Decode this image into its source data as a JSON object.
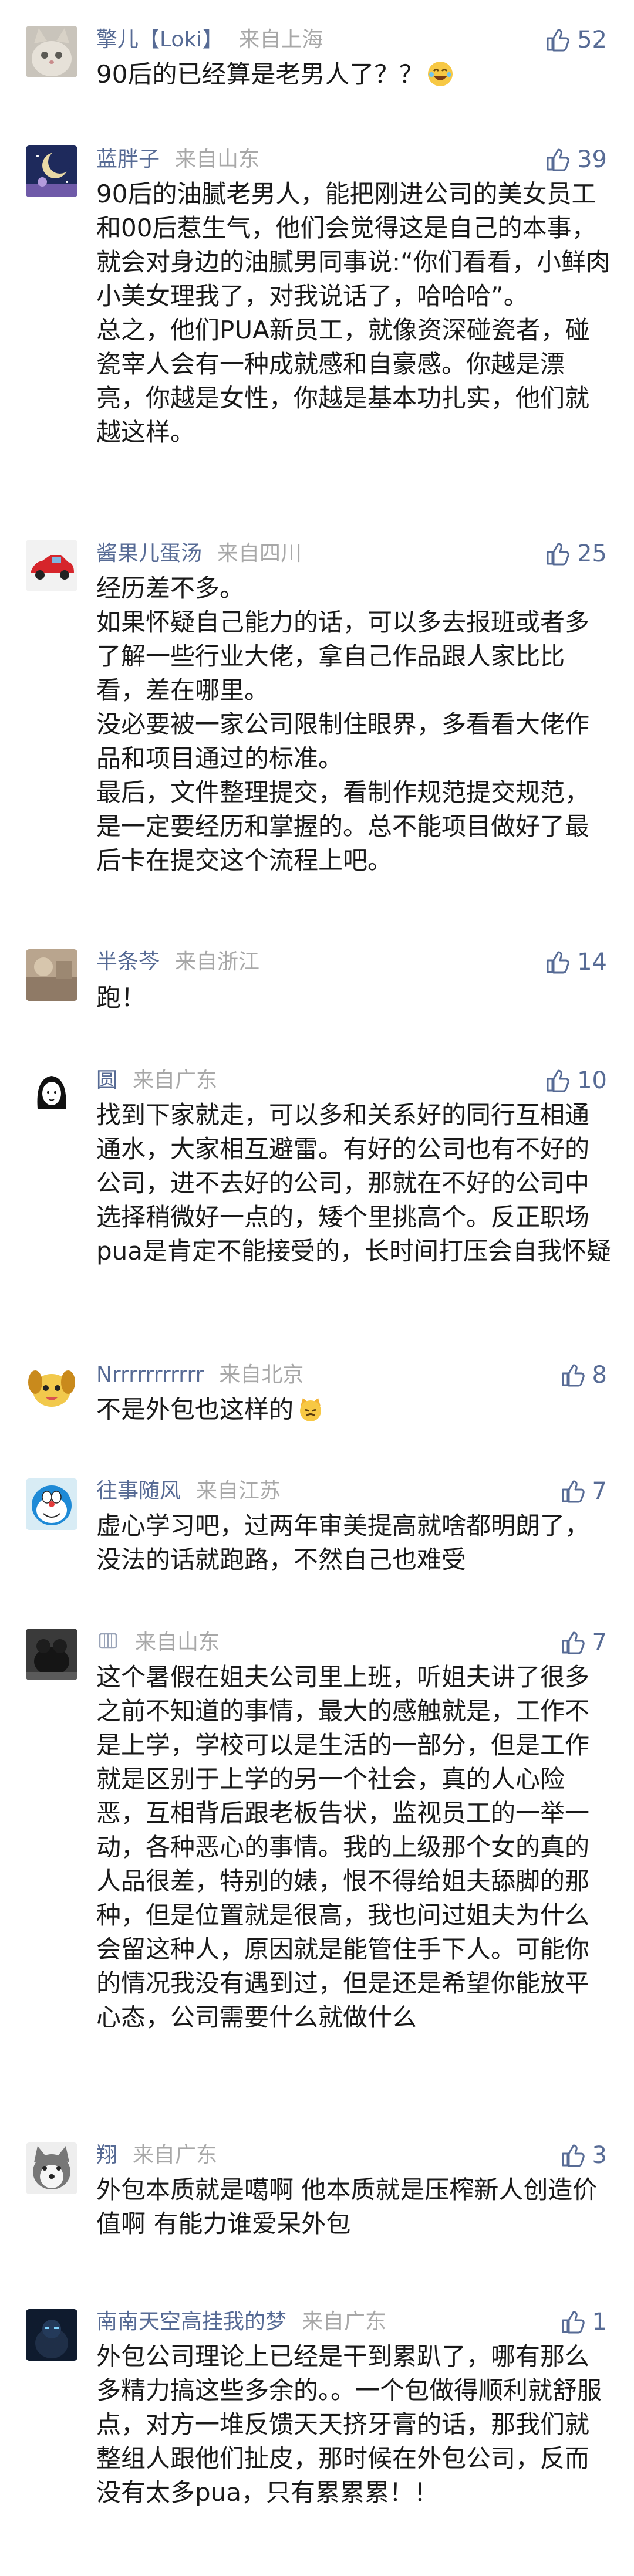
{
  "colors": {
    "nickname": "#576b95",
    "location": "#a8a8a8",
    "text": "#1a1a1a",
    "like": "#576b95"
  },
  "comments": [
    {
      "nickname": "擎儿【Loki】",
      "location": "来自上海",
      "likes": "52",
      "avatar": "cat-avatar",
      "paragraphs": [
        "90后的已经算是老男人了？？"
      ],
      "emoji": "laughing-emoji"
    },
    {
      "nickname": "蓝胖子",
      "location": "来自山东",
      "likes": "39",
      "avatar": "moon-night-avatar",
      "paragraphs": [
        "90后的油腻老男人，能把刚进公司的美女员工和00后惹生气，他们会觉得这是自己的本事，就会对身边的油腻男同事说:“你们看看，小鲜肉小美女理我了，对我说话了，哈哈哈”。",
        "总之，他们PUA新员工，就像资深碰瓷者，碰瓷宰人会有一种成就感和自豪感。你越是漂亮，你越是女性，你越是基本功扎实，他们就越这样。"
      ]
    },
    {
      "nickname": "酱果儿蛋汤",
      "location": "来自四川",
      "likes": "25",
      "avatar": "red-car-avatar",
      "paragraphs": [
        "经历差不多。",
        "如果怀疑自己能力的话，可以多去报班或者多了解一些行业大佬，拿自己作品跟人家比比看，差在哪里。",
        "没必要被一家公司限制住眼界，多看看大佬作品和项目通过的标准。",
        "最后，文件整理提交，看制作规范提交规范，是一定要经历和掌握的。总不能项目做好了最后卡在提交这个流程上吧。"
      ]
    },
    {
      "nickname": "半条芩",
      "location": "来自浙江",
      "likes": "14",
      "avatar": "blurry-photo-avatar",
      "paragraphs": [
        "跑！"
      ]
    },
    {
      "nickname": "圆",
      "location": "来自广东",
      "likes": "10",
      "avatar": "girl-sketch-avatar",
      "paragraphs": [
        "找到下家就走，可以多和关系好的同行互相通通水，大家相互避雷。有好的公司也有不好的公司，进不去好的公司，那就在不好的公司中选择稍微好一点的，矮个里挑高个。反正职场pua是肯定不能接受的，长时间打压会自我怀疑"
      ]
    },
    {
      "nickname": "Nrrrrrrrrrrr",
      "location": "来自北京",
      "likes": "8",
      "avatar": "cartoon-dog-avatar",
      "paragraphs": [
        "不是外包也这样的"
      ],
      "emoji": "cat-face-emoji"
    },
    {
      "nickname": "往事随风",
      "location": "来自江苏",
      "likes": "7",
      "avatar": "doraemon-avatar",
      "paragraphs": [
        "虚心学习吧，过两年审美提高就啥都明朗了，没法的话就跑路，不然自己也难受"
      ]
    },
    {
      "nickname": "",
      "location": "来自山东",
      "likes": "7",
      "avatar": "dark-animal-avatar",
      "nickname_icon": "symbol-icon",
      "paragraphs": [
        "这个暑假在姐夫公司里上班，听姐夫讲了很多之前不知道的事情，最大的感触就是，工作不是上学，学校可以是生活的一部分，但是工作就是区别于上学的另一个社会，真的人心险恶，互相背后跟老板告状，监视员工的一举一动，各种恶心的事情。我的上级那个女的真的人品很差，特别的婊，恨不得给姐夫舔脚的那种，但是位置就是很高，我也问过姐夫为什么会留这种人，原因就是能管住手下人。可能你的情况我没有遇到过，但是还是希望你能放平心态，公司需要什么就做什么"
      ]
    },
    {
      "nickname": "翔",
      "location": "来自广东",
      "likes": "3",
      "avatar": "husky-avatar",
      "paragraphs": [
        "外包本质就是噶啊 他本质就是压榨新人创造价值啊 有能力谁爱呆外包"
      ]
    },
    {
      "nickname": "南南天空高挂我的梦",
      "location": "来自广东",
      "likes": "1",
      "avatar": "dark-figure-avatar",
      "paragraphs": [
        "外包公司理论上已经是干到累趴了，哪有那么多精力搞这些多余的。。一个包做得顺利就舒服点，对方一堆反馈天天挤牙膏的话，那我们就整组人跟他们扯皮，那时候在外包公司，反而没有太多pua，只有累累累！！"
      ]
    }
  ]
}
